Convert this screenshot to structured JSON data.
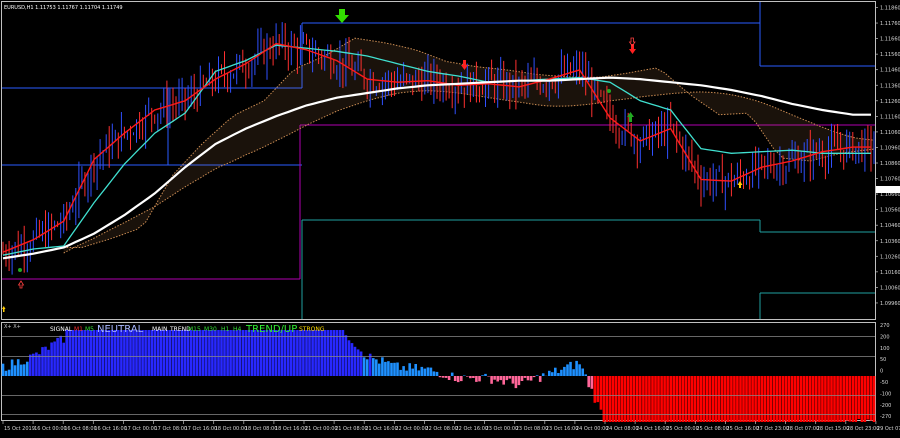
{
  "window": {
    "title": "EURUSD,H1  1.11753 1.11767 1.11704 1.11749"
  },
  "colors": {
    "tenkan": "#ff1a1a",
    "kijun": "#40e0d0",
    "ma": "#ffffff",
    "cloud": "#c98b52",
    "candle_up": "#3050ff",
    "candle_down": "#ff3030",
    "histo_up": "#1e90ff",
    "histo_up_strong": "#2828ff",
    "histo_down": "#ff6699",
    "histo_down_strong": "#ff0000",
    "frame": "#c0c0c0"
  },
  "price_axis": {
    "min": 1.0986,
    "max": 1.1188,
    "ticks": [
      "1.11860",
      "1.11760",
      "1.11660",
      "1.11560",
      "1.11460",
      "1.11360",
      "1.11260",
      "1.11160",
      "1.11060",
      "1.10960",
      "1.10860",
      "1.10760",
      "1.10660",
      "1.10560",
      "1.10460",
      "1.10360",
      "1.10260",
      "1.10160",
      "1.10060",
      "1.09960"
    ]
  },
  "indicator": {
    "header_left": "X+ X+",
    "signal_label": "SIGNAL",
    "signal_tfs": [
      "M1",
      "M5"
    ],
    "signal_value": "NEUTRAL",
    "main_label": "MAIN",
    "trend_label": "TREND",
    "trend_tfs": [
      "M15",
      "M30",
      "H1",
      "H4"
    ],
    "trend_value": "TREND/UP",
    "strength_value": "STRONG",
    "axis_ticks": [
      "270",
      "200",
      "100",
      "50",
      "0",
      "-50",
      "-100",
      "-200",
      "-270"
    ]
  },
  "time_axis": {
    "labels": [
      "15 Oct 2019",
      "16 Oct 00:00",
      "16 Oct 08:00",
      "16 Oct 16:00",
      "17 Oct 00:00",
      "17 Oct 08:00",
      "17 Oct 16:00",
      "18 Oct 00:00",
      "18 Oct 08:00",
      "18 Oct 16:00",
      "21 Oct 00:00",
      "21 Oct 08:00",
      "21 Oct 16:00",
      "22 Oct 00:00",
      "22 Oct 08:00",
      "22 Oct 16:00",
      "23 Oct 00:00",
      "23 Oct 08:00",
      "23 Oct 16:00",
      "24 Oct 00:00",
      "24 Oct 08:00",
      "24 Oct 16:00",
      "25 Oct 00:00",
      "25 Oct 08:00",
      "25 Oct 16:00",
      "27 Oct 23:00",
      "28 Oct 07:00",
      "28 Oct 15:00",
      "28 Oct 23:00",
      "29 Oct 07:00"
    ]
  },
  "chart_data": {
    "type": "line",
    "symbol": "EURUSD",
    "timeframe": "H1",
    "ylim": [
      1.0986,
      1.1188
    ],
    "series": [
      {
        "id": "tenkan",
        "x": [
          0,
          10,
          20,
          30,
          40,
          50,
          60,
          70,
          80,
          90,
          100,
          110,
          120,
          130,
          140,
          150,
          160,
          170,
          180,
          190,
          200,
          210,
          220,
          230,
          240,
          250,
          260,
          270,
          280
        ],
        "y": [
          1.1028,
          1.1036,
          1.1048,
          1.1088,
          1.1105,
          1.112,
          1.1126,
          1.114,
          1.115,
          1.1163,
          1.1159,
          1.1152,
          1.114,
          1.1138,
          1.1139,
          1.1136,
          1.1137,
          1.1135,
          1.114,
          1.1146,
          1.1115,
          1.11,
          1.1108,
          1.1075,
          1.1074,
          1.1083,
          1.1087,
          1.1093,
          1.1096
        ]
      },
      {
        "id": "kijun",
        "x": [
          0,
          10,
          20,
          30,
          40,
          50,
          60,
          70,
          80,
          90,
          100,
          110,
          120,
          130,
          140,
          150,
          160,
          170,
          180,
          190,
          200,
          210,
          220,
          230,
          240,
          250,
          260,
          270,
          280
        ],
        "y": [
          1.1026,
          1.103,
          1.1032,
          1.106,
          1.1085,
          1.1105,
          1.1118,
          1.1145,
          1.1152,
          1.1162,
          1.116,
          1.1158,
          1.1155,
          1.115,
          1.1145,
          1.1142,
          1.1138,
          1.1139,
          1.114,
          1.1141,
          1.1138,
          1.1126,
          1.112,
          1.1095,
          1.1092,
          1.1093,
          1.1094,
          1.1092,
          1.1092
        ]
      },
      {
        "id": "ma",
        "x": [
          0,
          10,
          20,
          30,
          40,
          50,
          60,
          70,
          80,
          90,
          100,
          110,
          120,
          130,
          140,
          150,
          160,
          170,
          180,
          190,
          200,
          210,
          220,
          230,
          240,
          250,
          260,
          270,
          280
        ],
        "y": [
          1.1024,
          1.1027,
          1.1031,
          1.104,
          1.1052,
          1.1066,
          1.1083,
          1.1098,
          1.1108,
          1.1116,
          1.1123,
          1.1128,
          1.1131,
          1.1134,
          1.1136,
          1.1137,
          1.1138,
          1.1139,
          1.1139,
          1.114,
          1.1141,
          1.114,
          1.1138,
          1.1136,
          1.1133,
          1.1129,
          1.1124,
          1.112,
          1.1117
        ]
      }
    ]
  }
}
